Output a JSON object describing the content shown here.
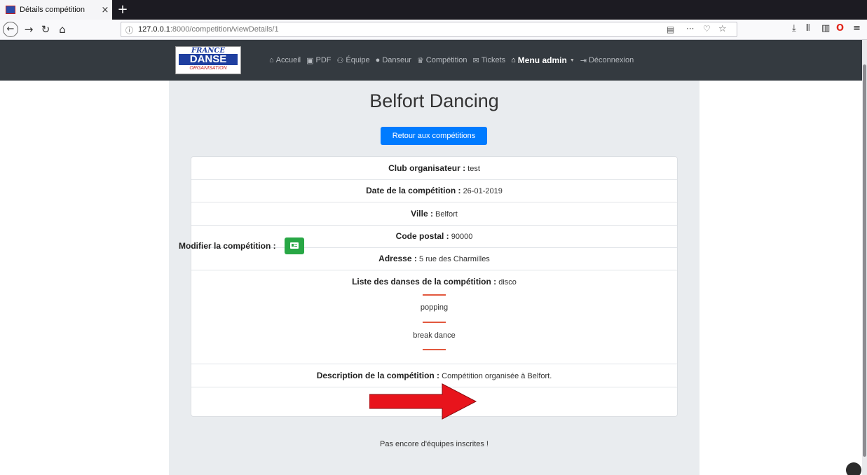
{
  "browser": {
    "tab_title": "Détails compétition",
    "tab_close": "×",
    "new_tab": "+",
    "url_host": "127.0.0.1",
    "url_rest": ":8000/competition/viewDetails/1",
    "url_more": "···"
  },
  "nav": {
    "logo_top": "FRANCE",
    "logo_main": "DANSE",
    "logo_sub": "ORGANISATION",
    "items": [
      {
        "label": "Accueil",
        "icon": "home-icon"
      },
      {
        "label": "PDF",
        "icon": "print-icon"
      },
      {
        "label": "Équipe",
        "icon": "team-icon"
      },
      {
        "label": "Danseur",
        "icon": "user-icon"
      },
      {
        "label": "Compétition",
        "icon": "trophy-icon"
      },
      {
        "label": "Tickets",
        "icon": "envelope-icon"
      },
      {
        "label": "Menu admin",
        "icon": "admin-icon"
      },
      {
        "label": "Déconnexion",
        "icon": "logout-icon"
      }
    ]
  },
  "page": {
    "title": "Belfort Dancing",
    "back_button": "Retour aux compétitions",
    "no_teams": "Pas encore d'équipes inscrites !"
  },
  "details": {
    "club_label": "Club organisateur :",
    "club_value": "test",
    "date_label": "Date de la compétition :",
    "date_value": "26-01-2019",
    "city_label": "Ville :",
    "city_value": "Belfort",
    "zip_label": "Code postal :",
    "zip_value": "90000",
    "address_label": "Adresse :",
    "address_value": "5 rue des Charmilles",
    "dances_label": "Liste des danses de la compétition :",
    "dances": [
      "disco",
      "popping",
      "break dance"
    ],
    "description_label": "Description de la compétition :",
    "description_value": "Compétition organisée à Belfort.",
    "edit_label": "Modifier la compétition :"
  },
  "colors": {
    "navbar": "#343a40",
    "primary": "#007bff",
    "success": "#28a745",
    "separator": "#e2583e",
    "annotation_arrow": "#e8141c"
  }
}
